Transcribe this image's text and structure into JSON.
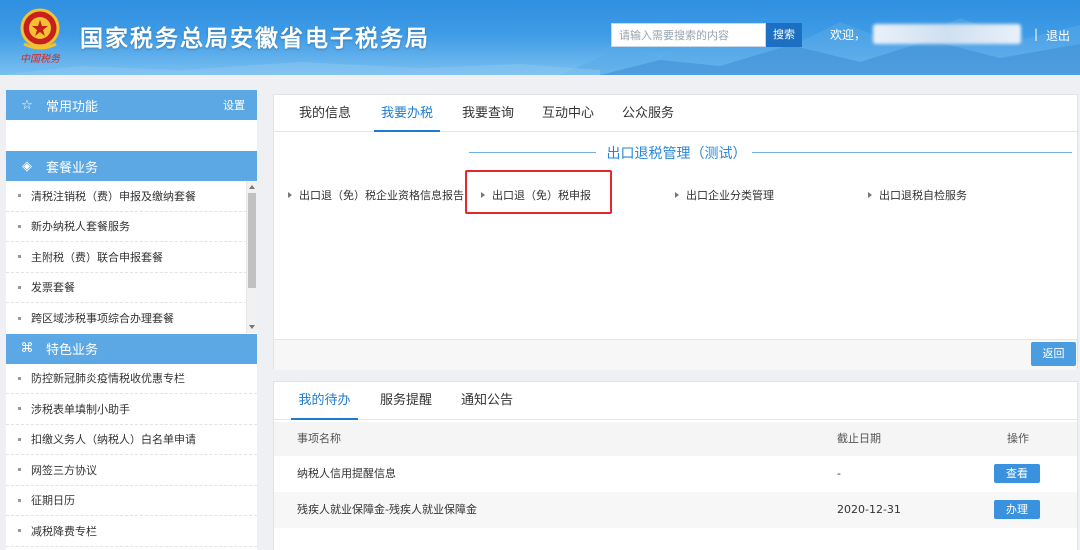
{
  "header": {
    "site_title": "国家税务总局安徽省电子税务局",
    "emblem_text": "中国税务",
    "search_placeholder": "请输入需要搜索的内容",
    "search_button": "搜索",
    "welcome": "欢迎，",
    "separator": "|",
    "logout": "退出",
    "colors": {
      "header_top": "#2f8fe0",
      "header_bottom": "#79bff0",
      "search_button_bg": "#1d6fc1"
    }
  },
  "sidebar": {
    "common": {
      "icon": "star-icon",
      "title": "常用功能",
      "setting": "设置"
    },
    "package": {
      "icon": "layers-icon",
      "title": "套餐业务",
      "items": [
        "清税注销税（费）申报及缴纳套餐",
        "新办纳税人套餐服务",
        "主附税（费）联合申报套餐",
        "发票套餐",
        "跨区域涉税事项综合办理套餐"
      ]
    },
    "feature": {
      "icon": "grid-icon",
      "title": "特色业务",
      "items": [
        "防控新冠肺炎疫情税收优惠专栏",
        "涉税表单填制小助手",
        "扣缴义务人（纳税人）白名单申请",
        "网签三方协议",
        "征期日历",
        "减税降费专栏"
      ]
    },
    "colors": {
      "section_header_bg": "#5ba8e5"
    }
  },
  "main_panel": {
    "tabs": [
      "我的信息",
      "我要办税",
      "我要查询",
      "互动中心",
      "公众服务"
    ],
    "active_tab": "我要办税",
    "section_title": "出口退税管理（测试）",
    "menu_items": [
      "出口退（免）税企业资格信息报告",
      "出口退（免）税申报",
      "出口企业分类管理",
      "出口退税自检服务"
    ],
    "highlighted_item": "出口退（免）税申报",
    "back_button": "返回",
    "colors": {
      "accent": "#1f7bd0",
      "highlight_border": "#e0282e"
    }
  },
  "todo_panel": {
    "tabs": [
      "我的待办",
      "服务提醒",
      "通知公告"
    ],
    "active_tab": "我的待办",
    "columns": [
      "事项名称",
      "截止日期",
      "操作"
    ],
    "rows": [
      {
        "name": "纳税人信用提醒信息",
        "deadline": "-",
        "action": "查看"
      },
      {
        "name": "残疾人就业保障金-残疾人就业保障金",
        "deadline": "2020-12-31",
        "action": "办理"
      }
    ]
  }
}
